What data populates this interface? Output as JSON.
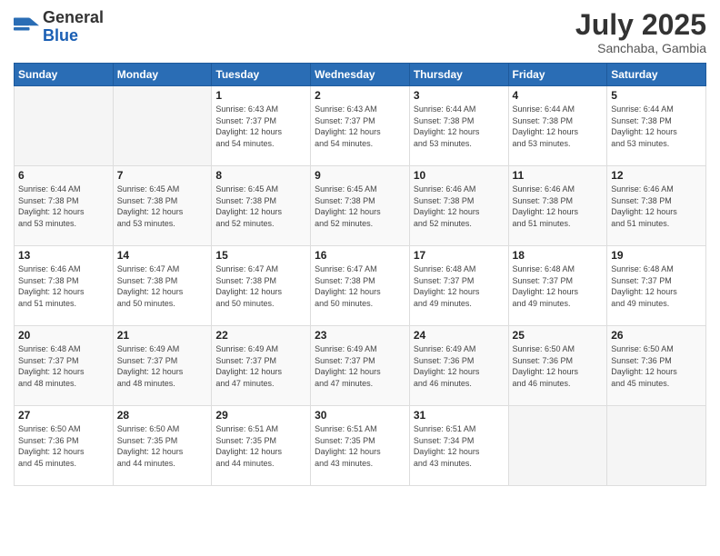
{
  "logo": {
    "general": "General",
    "blue": "Blue"
  },
  "title": {
    "month": "July 2025",
    "location": "Sanchaba, Gambia"
  },
  "headers": [
    "Sunday",
    "Monday",
    "Tuesday",
    "Wednesday",
    "Thursday",
    "Friday",
    "Saturday"
  ],
  "weeks": [
    [
      {
        "day": "",
        "info": ""
      },
      {
        "day": "",
        "info": ""
      },
      {
        "day": "1",
        "info": "Sunrise: 6:43 AM\nSunset: 7:37 PM\nDaylight: 12 hours\nand 54 minutes."
      },
      {
        "day": "2",
        "info": "Sunrise: 6:43 AM\nSunset: 7:37 PM\nDaylight: 12 hours\nand 54 minutes."
      },
      {
        "day": "3",
        "info": "Sunrise: 6:44 AM\nSunset: 7:38 PM\nDaylight: 12 hours\nand 53 minutes."
      },
      {
        "day": "4",
        "info": "Sunrise: 6:44 AM\nSunset: 7:38 PM\nDaylight: 12 hours\nand 53 minutes."
      },
      {
        "day": "5",
        "info": "Sunrise: 6:44 AM\nSunset: 7:38 PM\nDaylight: 12 hours\nand 53 minutes."
      }
    ],
    [
      {
        "day": "6",
        "info": "Sunrise: 6:44 AM\nSunset: 7:38 PM\nDaylight: 12 hours\nand 53 minutes."
      },
      {
        "day": "7",
        "info": "Sunrise: 6:45 AM\nSunset: 7:38 PM\nDaylight: 12 hours\nand 53 minutes."
      },
      {
        "day": "8",
        "info": "Sunrise: 6:45 AM\nSunset: 7:38 PM\nDaylight: 12 hours\nand 52 minutes."
      },
      {
        "day": "9",
        "info": "Sunrise: 6:45 AM\nSunset: 7:38 PM\nDaylight: 12 hours\nand 52 minutes."
      },
      {
        "day": "10",
        "info": "Sunrise: 6:46 AM\nSunset: 7:38 PM\nDaylight: 12 hours\nand 52 minutes."
      },
      {
        "day": "11",
        "info": "Sunrise: 6:46 AM\nSunset: 7:38 PM\nDaylight: 12 hours\nand 51 minutes."
      },
      {
        "day": "12",
        "info": "Sunrise: 6:46 AM\nSunset: 7:38 PM\nDaylight: 12 hours\nand 51 minutes."
      }
    ],
    [
      {
        "day": "13",
        "info": "Sunrise: 6:46 AM\nSunset: 7:38 PM\nDaylight: 12 hours\nand 51 minutes."
      },
      {
        "day": "14",
        "info": "Sunrise: 6:47 AM\nSunset: 7:38 PM\nDaylight: 12 hours\nand 50 minutes."
      },
      {
        "day": "15",
        "info": "Sunrise: 6:47 AM\nSunset: 7:38 PM\nDaylight: 12 hours\nand 50 minutes."
      },
      {
        "day": "16",
        "info": "Sunrise: 6:47 AM\nSunset: 7:38 PM\nDaylight: 12 hours\nand 50 minutes."
      },
      {
        "day": "17",
        "info": "Sunrise: 6:48 AM\nSunset: 7:37 PM\nDaylight: 12 hours\nand 49 minutes."
      },
      {
        "day": "18",
        "info": "Sunrise: 6:48 AM\nSunset: 7:37 PM\nDaylight: 12 hours\nand 49 minutes."
      },
      {
        "day": "19",
        "info": "Sunrise: 6:48 AM\nSunset: 7:37 PM\nDaylight: 12 hours\nand 49 minutes."
      }
    ],
    [
      {
        "day": "20",
        "info": "Sunrise: 6:48 AM\nSunset: 7:37 PM\nDaylight: 12 hours\nand 48 minutes."
      },
      {
        "day": "21",
        "info": "Sunrise: 6:49 AM\nSunset: 7:37 PM\nDaylight: 12 hours\nand 48 minutes."
      },
      {
        "day": "22",
        "info": "Sunrise: 6:49 AM\nSunset: 7:37 PM\nDaylight: 12 hours\nand 47 minutes."
      },
      {
        "day": "23",
        "info": "Sunrise: 6:49 AM\nSunset: 7:37 PM\nDaylight: 12 hours\nand 47 minutes."
      },
      {
        "day": "24",
        "info": "Sunrise: 6:49 AM\nSunset: 7:36 PM\nDaylight: 12 hours\nand 46 minutes."
      },
      {
        "day": "25",
        "info": "Sunrise: 6:50 AM\nSunset: 7:36 PM\nDaylight: 12 hours\nand 46 minutes."
      },
      {
        "day": "26",
        "info": "Sunrise: 6:50 AM\nSunset: 7:36 PM\nDaylight: 12 hours\nand 45 minutes."
      }
    ],
    [
      {
        "day": "27",
        "info": "Sunrise: 6:50 AM\nSunset: 7:36 PM\nDaylight: 12 hours\nand 45 minutes."
      },
      {
        "day": "28",
        "info": "Sunrise: 6:50 AM\nSunset: 7:35 PM\nDaylight: 12 hours\nand 44 minutes."
      },
      {
        "day": "29",
        "info": "Sunrise: 6:51 AM\nSunset: 7:35 PM\nDaylight: 12 hours\nand 44 minutes."
      },
      {
        "day": "30",
        "info": "Sunrise: 6:51 AM\nSunset: 7:35 PM\nDaylight: 12 hours\nand 43 minutes."
      },
      {
        "day": "31",
        "info": "Sunrise: 6:51 AM\nSunset: 7:34 PM\nDaylight: 12 hours\nand 43 minutes."
      },
      {
        "day": "",
        "info": ""
      },
      {
        "day": "",
        "info": ""
      }
    ]
  ]
}
